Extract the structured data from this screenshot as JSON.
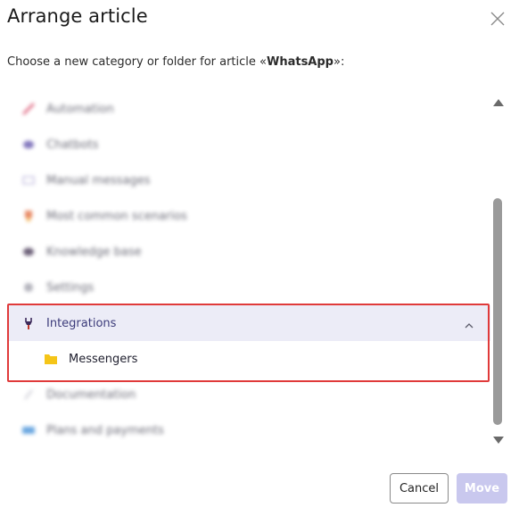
{
  "dialog": {
    "title": "Arrange article",
    "subtitle_prefix": "Choose a new category or folder for article «",
    "article_name": "WhatsApp",
    "subtitle_suffix": "»:"
  },
  "categories": [
    {
      "label": "Automation",
      "icon": "rocket-icon"
    },
    {
      "label": "Chatbots",
      "icon": "bot-icon"
    },
    {
      "label": "Manual messages",
      "icon": "envelope-icon"
    },
    {
      "label": "Most common scenarios",
      "icon": "trophy-icon"
    },
    {
      "label": "Knowledge base",
      "icon": "book-icon"
    },
    {
      "label": "Settings",
      "icon": "gear-icon"
    },
    {
      "label": "Integrations",
      "icon": "plug-icon"
    },
    {
      "label": "Messengers",
      "icon": "folder-icon"
    },
    {
      "label": "Documentation",
      "icon": "pencil-icon"
    },
    {
      "label": "Plans and payments",
      "icon": "credit-card-icon"
    }
  ],
  "buttons": {
    "cancel": "Cancel",
    "move": "Move"
  },
  "colors": {
    "accent_light": "#c9c8ee",
    "selected_bg": "#ececf7",
    "highlight_border": "#e03a3a",
    "folder": "#f5c518"
  }
}
